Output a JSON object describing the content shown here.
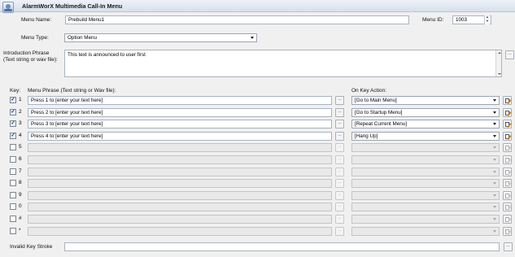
{
  "header": {
    "title": "AlarmWorX Multimedia Call-In Menu"
  },
  "menu_name": {
    "label": "Menu Name:",
    "value": "Prebuild Menu1"
  },
  "menu_id": {
    "label": "Menu ID:",
    "value": "1003"
  },
  "menu_type": {
    "label": "Menu Type:",
    "value": "Option Menu"
  },
  "intro": {
    "label_line1": "Introduction Phrase",
    "label_line2": "(Text string or wav file):",
    "value": "This text is announced to user first",
    "browse_label": "..."
  },
  "columns": {
    "key": "Key:",
    "phrase": "Menu Phrase (Text string or Wav file):",
    "action": "On Key Action:"
  },
  "rows": [
    {
      "key": "1",
      "checked": true,
      "phrase": "Press 1 to [enter your text here]",
      "action": "[Go to Main Menu]",
      "browse": "..."
    },
    {
      "key": "2",
      "checked": true,
      "phrase": "Press 2 to [enter your text here]",
      "action": "[Go to Startup Menu]",
      "browse": "..."
    },
    {
      "key": "3",
      "checked": true,
      "phrase": "Press 3 to [enter your text here]",
      "action": "[Repeat Current Menu]",
      "browse": "..."
    },
    {
      "key": "4",
      "checked": true,
      "phrase": "Press 4 to [enter your text here]",
      "action": "[Hang Up]",
      "browse": "..."
    },
    {
      "key": "5",
      "checked": false,
      "phrase": "",
      "action": "",
      "browse": "..."
    },
    {
      "key": "6",
      "checked": false,
      "phrase": "",
      "action": "",
      "browse": "..."
    },
    {
      "key": "7",
      "checked": false,
      "phrase": "",
      "action": "",
      "browse": "..."
    },
    {
      "key": "8",
      "checked": false,
      "phrase": "",
      "action": "",
      "browse": "..."
    },
    {
      "key": "9",
      "checked": false,
      "phrase": "",
      "action": "",
      "browse": "..."
    },
    {
      "key": "0",
      "checked": false,
      "phrase": "",
      "action": "",
      "browse": "..."
    },
    {
      "key": "#",
      "checked": false,
      "phrase": "",
      "action": "",
      "browse": "..."
    },
    {
      "key": "*",
      "checked": false,
      "phrase": "",
      "action": "",
      "browse": "..."
    }
  ],
  "invalid": {
    "label": "Invalid Key Stroke",
    "value": "",
    "browse_label": "..."
  },
  "glyphs": {
    "check": "✓",
    "spin_up": "▲",
    "spin_down": "▼"
  }
}
